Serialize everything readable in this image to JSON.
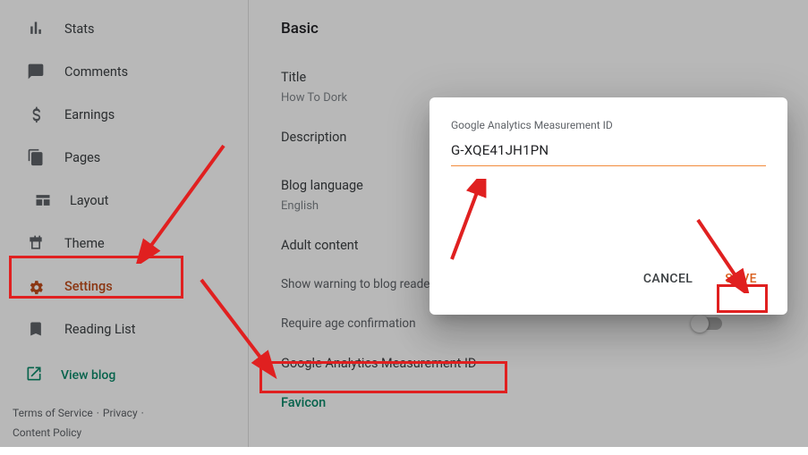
{
  "sidebar": {
    "items": [
      {
        "label": "Stats"
      },
      {
        "label": "Comments"
      },
      {
        "label": "Earnings"
      },
      {
        "label": "Pages"
      },
      {
        "label": "Layout"
      },
      {
        "label": "Theme"
      },
      {
        "label": "Settings"
      },
      {
        "label": "Reading List"
      }
    ],
    "view_blog": "View blog"
  },
  "footer": {
    "terms": "Terms of Service",
    "privacy": "Privacy",
    "content_policy": "Content Policy"
  },
  "main": {
    "section": "Basic",
    "title_label": "Title",
    "title_value": "How To Dork",
    "description_label": "Description",
    "language_label": "Blog language",
    "language_value": "English",
    "adult_label": "Adult content",
    "warning_label": "Show warning to blog readers",
    "age_confirm_label": "Require age confirmation",
    "ga_label": "Google Analytics Measurement ID",
    "favicon_label": "Favicon"
  },
  "dialog": {
    "label": "Google Analytics Measurement ID",
    "value": "G-XQE41JH1PN",
    "cancel": "CANCEL",
    "save": "SAVE"
  }
}
